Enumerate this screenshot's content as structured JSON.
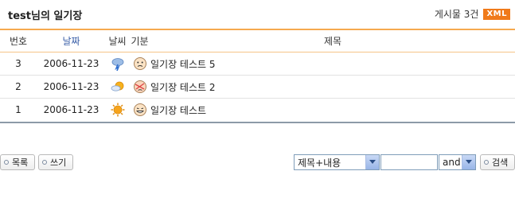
{
  "board": {
    "title": "test님의 일기장",
    "count_text": "게시물 3건",
    "xml_label": "XML"
  },
  "columns": {
    "number": "번호",
    "date": "날짜",
    "weather": "날씨",
    "mood": "기분",
    "subject": "제목"
  },
  "rows": [
    {
      "number": "3",
      "date": "2006-11-23",
      "weather_icon": "rain-cloud-icon",
      "mood_icon": "worried-face-icon",
      "subject": "일기장 테스트 5"
    },
    {
      "number": "2",
      "date": "2006-11-23",
      "weather_icon": "sun-cloud-icon",
      "mood_icon": "bandaged-face-icon",
      "subject": "일기장 테스트 2"
    },
    {
      "number": "1",
      "date": "2006-11-23",
      "weather_icon": "sun-icon",
      "mood_icon": "grinning-face-icon",
      "subject": "일기장 테스트"
    }
  ],
  "buttons": {
    "list": "목록",
    "write": "쓰기",
    "search": "검색"
  },
  "search": {
    "target_selected": "제목+내용",
    "keyword_value": "",
    "operator_selected": "and"
  },
  "colors": {
    "accent_orange": "#f07a1a",
    "header_line": "#f6a94f",
    "bottom_line": "#8c9aa8",
    "date_header": "#3a5fa8"
  }
}
